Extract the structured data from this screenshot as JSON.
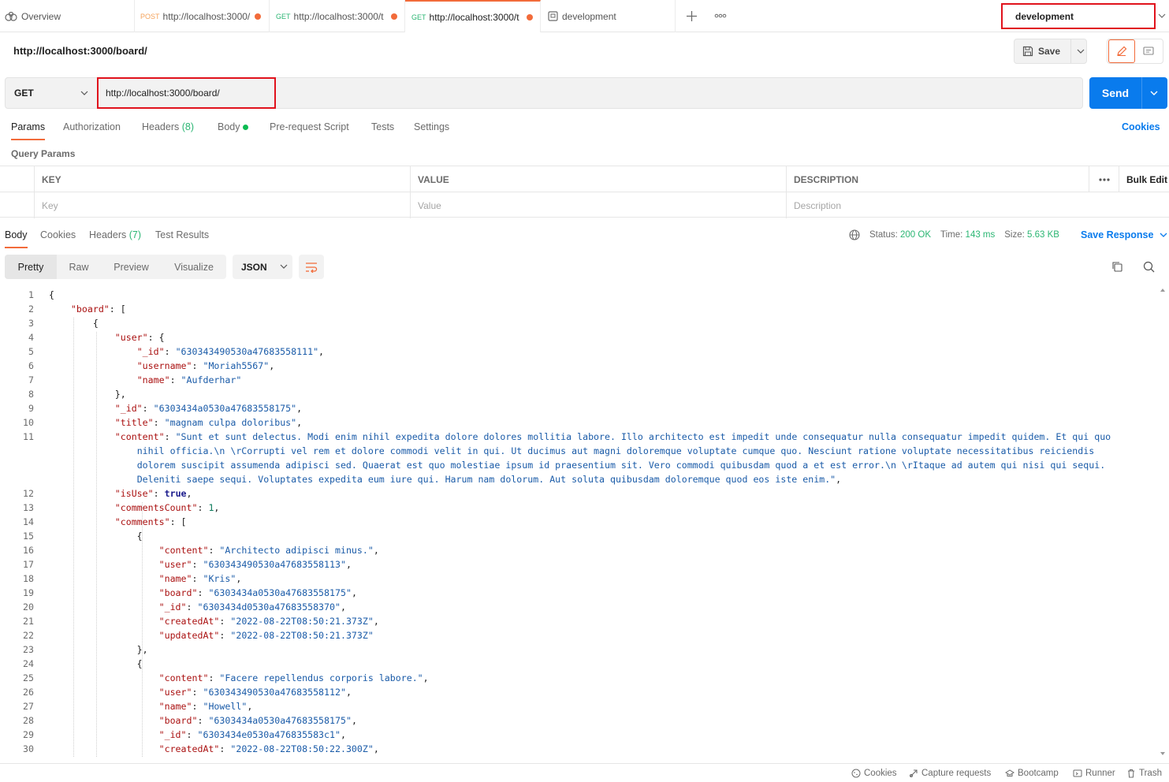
{
  "tabs": [
    {
      "label": "Overview"
    },
    {
      "method": "POST",
      "url": "http://localhost:3000/",
      "unsaved": true
    },
    {
      "method": "GET",
      "url": "http://localhost:3000/t",
      "unsaved": true
    },
    {
      "method": "GET",
      "url": "http://localhost:3000/t",
      "unsaved": true,
      "active": true
    },
    {
      "label": "development"
    }
  ],
  "environment": "development",
  "request": {
    "title": "http://localhost:3000/board/",
    "method": "GET",
    "url": "http://localhost:3000/board/",
    "save_label": "Save",
    "send_label": "Send"
  },
  "request_tabs": {
    "params": "Params",
    "authorization": "Authorization",
    "headers": "Headers",
    "headers_count": "(8)",
    "body": "Body",
    "pre_request": "Pre-request Script",
    "tests": "Tests",
    "settings": "Settings",
    "cookies": "Cookies"
  },
  "query_params": {
    "label": "Query Params",
    "columns": [
      "KEY",
      "VALUE",
      "DESCRIPTION"
    ],
    "bulk_edit": "Bulk Edit",
    "placeholders": [
      "Key",
      "Value",
      "Description"
    ]
  },
  "response": {
    "tabs": {
      "body": "Body",
      "cookies": "Cookies",
      "headers": "Headers",
      "headers_count": "(7)",
      "test_results": "Test Results"
    },
    "status_label": "Status:",
    "status": "200 OK",
    "time_label": "Time:",
    "time": "143 ms",
    "size_label": "Size:",
    "size": "5.63 KB",
    "save_response": "Save Response",
    "views": [
      "Pretty",
      "Raw",
      "Preview",
      "Visualize"
    ],
    "format": "JSON"
  },
  "code_lines": [
    {
      "n": "1",
      "t": "{"
    },
    {
      "n": "2",
      "t": "    \"board\": ["
    },
    {
      "n": "3",
      "t": "        {"
    },
    {
      "n": "4",
      "t": "            \"user\": {"
    },
    {
      "n": "5",
      "t": "                \"_id\": \"630343490530a47683558111\","
    },
    {
      "n": "6",
      "t": "                \"username\": \"Moriah5567\","
    },
    {
      "n": "7",
      "t": "                \"name\": \"Aufderhar\""
    },
    {
      "n": "8",
      "t": "            },"
    },
    {
      "n": "9",
      "t": "            \"_id\": \"6303434a0530a47683558175\","
    },
    {
      "n": "10",
      "t": "            \"title\": \"magnam culpa doloribus\","
    },
    {
      "n": "11",
      "t": "            \"content\": \"Sunt et sunt delectus. Modi enim nihil expedita dolore dolores mollitia labore. Illo architecto est impedit unde consequatur nulla consequatur impedit quidem. Et qui quo"
    },
    {
      "n": "",
      "t": "                nihil officia.\\n \\rCorrupti vel rem et dolore commodi velit in qui. Ut ducimus aut magni doloremque voluptate cumque quo. Nesciunt ratione voluptate necessitatibus reiciendis"
    },
    {
      "n": "",
      "t": "                dolorem suscipit assumenda adipisci sed. Quaerat est quo molestiae ipsum id praesentium sit. Vero commodi quibusdam quod a et est error.\\n \\rItaque ad autem qui nisi qui sequi."
    },
    {
      "n": "",
      "t": "                Deleniti saepe sequi. Voluptates expedita eum iure qui. Harum nam dolorum. Aut soluta quibusdam doloremque quod eos iste enim.\","
    },
    {
      "n": "12",
      "t": "            \"isUse\": true,"
    },
    {
      "n": "13",
      "t": "            \"commentsCount\": 1,"
    },
    {
      "n": "14",
      "t": "            \"comments\": ["
    },
    {
      "n": "15",
      "t": "                {"
    },
    {
      "n": "16",
      "t": "                    \"content\": \"Architecto adipisci minus.\","
    },
    {
      "n": "17",
      "t": "                    \"user\": \"630343490530a47683558113\","
    },
    {
      "n": "18",
      "t": "                    \"name\": \"Kris\","
    },
    {
      "n": "19",
      "t": "                    \"board\": \"6303434a0530a47683558175\","
    },
    {
      "n": "20",
      "t": "                    \"_id\": \"6303434d0530a47683558370\","
    },
    {
      "n": "21",
      "t": "                    \"createdAt\": \"2022-08-22T08:50:21.373Z\","
    },
    {
      "n": "22",
      "t": "                    \"updatedAt\": \"2022-08-22T08:50:21.373Z\""
    },
    {
      "n": "23",
      "t": "                },"
    },
    {
      "n": "24",
      "t": "                {"
    },
    {
      "n": "25",
      "t": "                    \"content\": \"Facere repellendus corporis labore.\","
    },
    {
      "n": "26",
      "t": "                    \"user\": \"630343490530a47683558112\","
    },
    {
      "n": "27",
      "t": "                    \"name\": \"Howell\","
    },
    {
      "n": "28",
      "t": "                    \"board\": \"6303434a0530a47683558175\","
    },
    {
      "n": "29",
      "t": "                    \"_id\": \"6303434e0530a476835583c1\","
    },
    {
      "n": "30",
      "t": "                    \"createdAt\": \"2022-08-22T08:50:22.300Z\","
    }
  ],
  "statusbar": [
    "Cookies",
    "Capture requests",
    "Bootcamp",
    "Runner",
    "Trash"
  ]
}
